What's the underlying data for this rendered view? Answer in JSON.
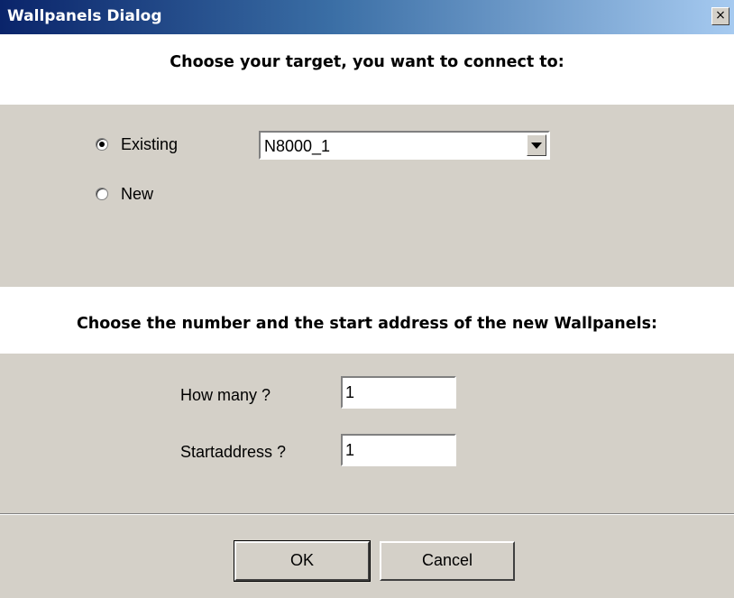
{
  "window": {
    "title": "Wallpanels Dialog",
    "close_glyph": "×"
  },
  "target_section": {
    "heading": "Choose your target, you want to connect to:",
    "options": [
      {
        "label": "Existing",
        "selected": true
      },
      {
        "label": "New",
        "selected": false
      }
    ],
    "target_select": {
      "value": "N8000_1",
      "icon": "chevron-down-icon"
    }
  },
  "wallpanels_section": {
    "heading": "Choose the number and the start address of the new Wallpanels:",
    "how_many_label": "How many ?",
    "how_many_value": "1",
    "start_address_label": "Startaddress ?",
    "start_address_value": "1"
  },
  "buttons": {
    "ok_label": "OK",
    "cancel_label": "Cancel"
  },
  "colors": {
    "title_bar_start": "#0a246a",
    "title_bar_end": "#a6caf0",
    "dialog_background": "#d4d0c8",
    "header_panel": "#ffffff"
  }
}
